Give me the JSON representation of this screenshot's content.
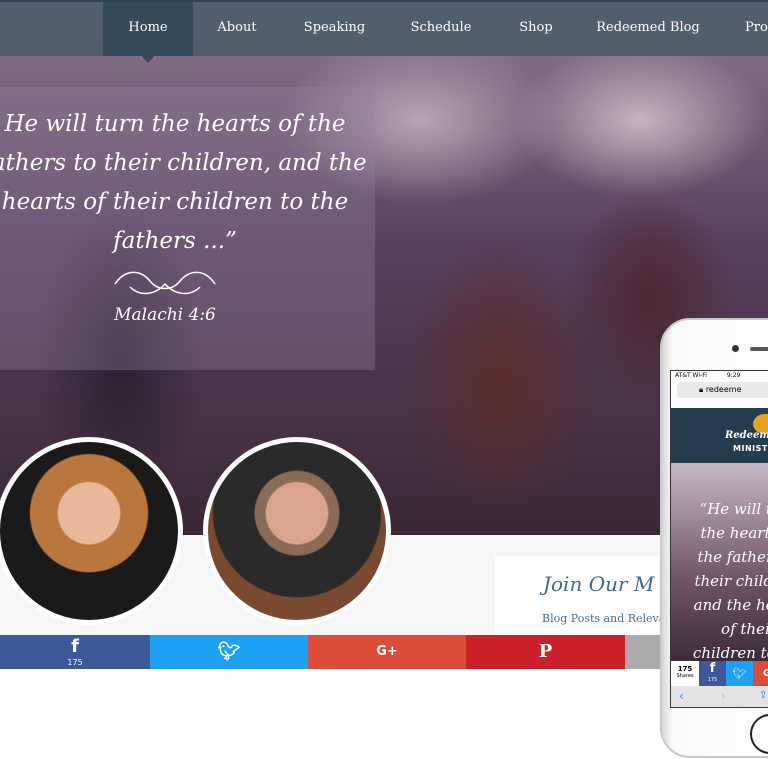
{
  "nav": {
    "items": [
      {
        "label": "Home",
        "active": true
      },
      {
        "label": "About"
      },
      {
        "label": "Speaking"
      },
      {
        "label": "Schedule"
      },
      {
        "label": "Shop"
      },
      {
        "label": "Redeemed Blog"
      },
      {
        "label": "Prom"
      }
    ]
  },
  "hero": {
    "quote": "He will turn the hearts of the fathers to their children, and the hearts of their children to the fathers ...”",
    "reference": "Malachi 4:6"
  },
  "newsletter": {
    "title": "Join Our M",
    "subtitle": "Blog Posts and Relevan"
  },
  "share": {
    "facebook_count": "175",
    "colors": {
      "facebook": "#3b5998",
      "twitter": "#1da1f2",
      "google": "#dd4b39",
      "pinterest": "#cb2027",
      "more": "#aaaaaa"
    }
  },
  "phone": {
    "carrier": "AT&T Wi-Fi",
    "time": "9:29",
    "url": "redeeme",
    "logo": "Redeeme",
    "logo_sub": "MINISTR",
    "quote": "“He will turn the hearts of the fathers to their children, and the hearts of their children to the fathers",
    "shares_count": "175",
    "shares_label": "Shares",
    "fb_count": "175"
  }
}
